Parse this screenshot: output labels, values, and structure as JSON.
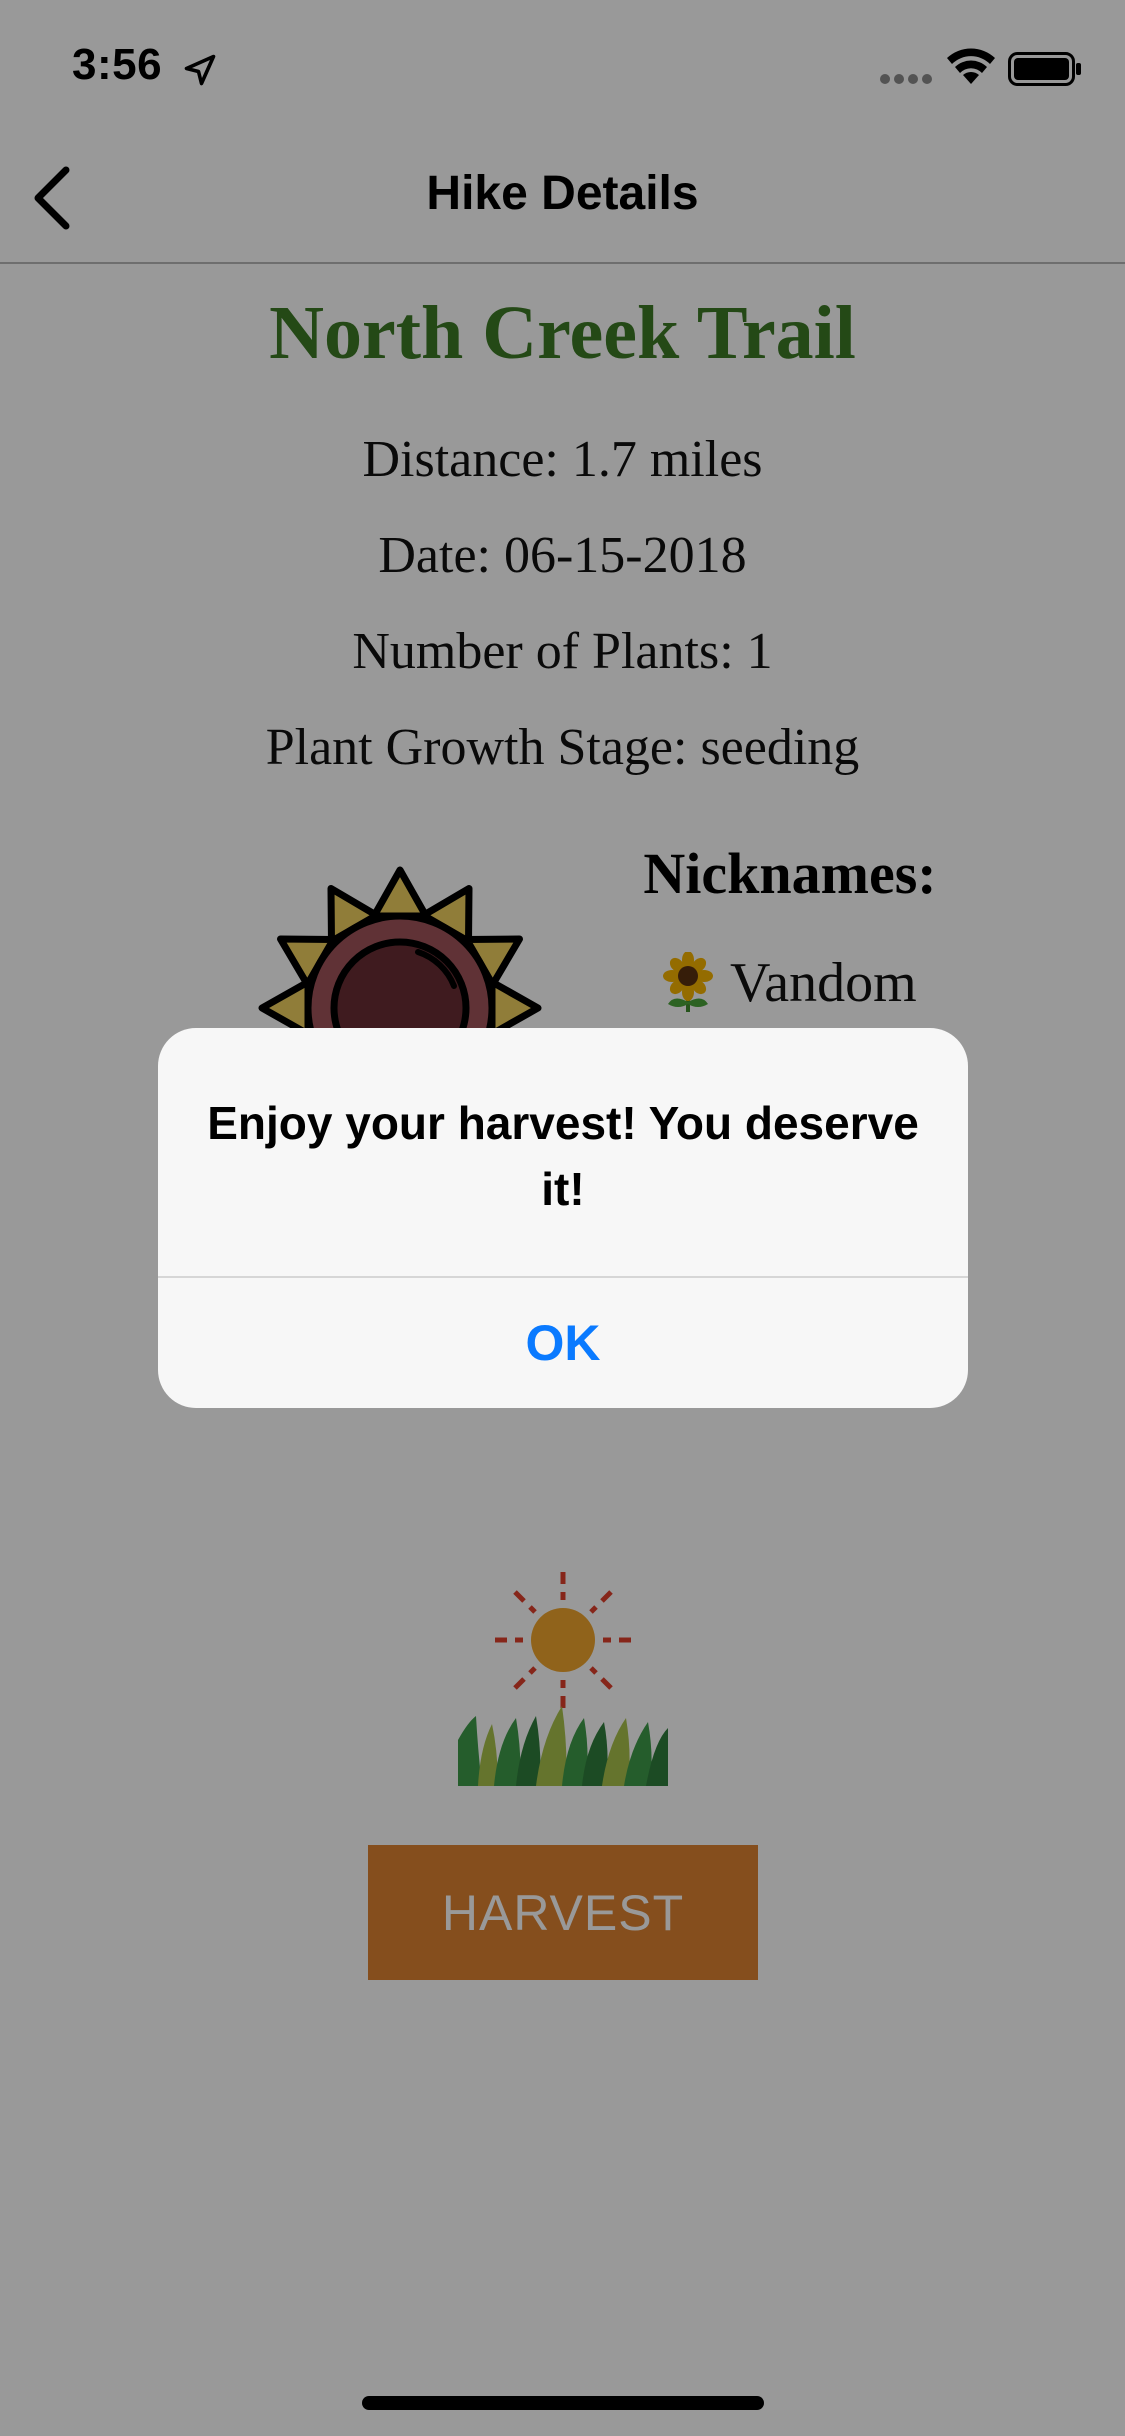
{
  "status_bar": {
    "time": "3:56"
  },
  "nav": {
    "title": "Hike Details"
  },
  "hike": {
    "trail_name": "North Creek Trail",
    "distance": "Distance: 1.7 miles",
    "date": "Date: 06-15-2018",
    "plant_count": "Number of Plants: 1",
    "growth_stage": "Plant Growth Stage: seeding"
  },
  "nicknames": {
    "title": "Nicknames:",
    "items": [
      "Vandom"
    ]
  },
  "harvest_button": {
    "label": "HARVEST"
  },
  "alert": {
    "message": "Enjoy your harvest! You deserve it!",
    "ok_label": "OK"
  },
  "colors": {
    "trail_green": "#3d7a26",
    "harvest_orange": "#de8231",
    "ios_blue": "#0a7aff"
  }
}
